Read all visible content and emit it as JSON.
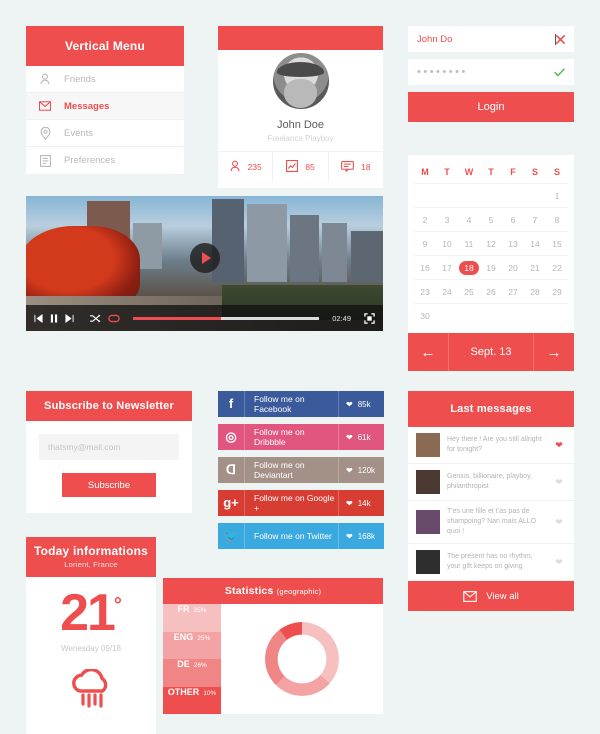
{
  "theme": {
    "accent": "#ef4e4e",
    "bg": "#eef3f4",
    "card": "#ffffff",
    "muted": "#b9b9b9"
  },
  "menu": {
    "title": "Vertical Menu",
    "items": [
      {
        "label": "Friends",
        "icon": "user-icon",
        "active": false
      },
      {
        "label": "Messages",
        "icon": "envelope-icon",
        "active": true
      },
      {
        "label": "Events",
        "icon": "location-pin-icon",
        "active": false
      },
      {
        "label": "Preferences",
        "icon": "list-icon",
        "active": false
      }
    ]
  },
  "profile": {
    "name": "John Doe",
    "role": "Freelance Playboy",
    "avatar_alt": "bearded man in captain hat",
    "stats": [
      {
        "icon": "user-icon",
        "value": "235"
      },
      {
        "icon": "chart-icon",
        "value": "85"
      },
      {
        "icon": "comment-icon",
        "value": "18"
      }
    ]
  },
  "login": {
    "username_value": "John Do",
    "username_clear_icon": "close-icon",
    "password_value": "••••••••",
    "password_valid_icon": "check-icon",
    "button_label": "Login"
  },
  "calendar": {
    "dow": [
      "M",
      "T",
      "W",
      "T",
      "F",
      "S",
      "S"
    ],
    "weeks": [
      [
        "",
        "",
        "",
        "",
        "",
        "",
        "1"
      ],
      [
        "2",
        "3",
        "4",
        "5",
        "6",
        "7",
        "8"
      ],
      [
        "9",
        "10",
        "11",
        "12",
        "13",
        "14",
        "15"
      ],
      [
        "16",
        "17",
        "18",
        "19",
        "20",
        "21",
        "22"
      ],
      [
        "23",
        "24",
        "25",
        "26",
        "27",
        "28",
        "29"
      ],
      [
        "30",
        "",
        "",
        "",
        "",
        "",
        ""
      ]
    ],
    "today": "18",
    "label": "Sept. 13",
    "prev_icon": "arrow-left-icon",
    "next_icon": "arrow-right-icon"
  },
  "video": {
    "image_alt": "city skyline with red autumn trees at sunset",
    "play_icon": "play-icon",
    "controls": [
      {
        "icon": "previous-icon"
      },
      {
        "icon": "pause-icon"
      },
      {
        "icon": "next-icon"
      },
      {
        "icon": "shuffle-icon"
      },
      {
        "icon": "repeat-icon"
      }
    ],
    "time": "02:49",
    "fullscreen_icon": "fullscreen-icon",
    "progress_percent": 47
  },
  "newsletter": {
    "title": "Subscribe to Newsletter",
    "email_placeholder": "thatsmy@mail.com",
    "email_value": "",
    "button_label": "Subscribe"
  },
  "socials": [
    {
      "network": "Facebook",
      "label": "Follow me on Facebook",
      "count": "85k",
      "glyph": "f",
      "color": "#3b5a9b",
      "icon": "facebook-icon"
    },
    {
      "network": "Dribbble",
      "label": "Follow me on Dribbble",
      "count": "61k",
      "glyph": "◎",
      "color": "#e0567f",
      "icon": "dribbble-icon"
    },
    {
      "network": "Deviantart",
      "label": "Follow me on Deviantart",
      "count": "120k",
      "glyph": "ᗡ",
      "color": "#a39188",
      "icon": "deviantart-icon"
    },
    {
      "network": "Google+",
      "label": "Follow me on Google +",
      "count": "14k",
      "glyph": "g+",
      "color": "#d73d32",
      "icon": "googleplus-icon"
    },
    {
      "network": "Twitter",
      "label": "Follow me on Twitter",
      "count": "168k",
      "glyph": "🐦",
      "color": "#3aa9e0",
      "icon": "twitter-icon"
    }
  ],
  "messages": {
    "title": "Last messages",
    "items": [
      {
        "text": "Hey there ! Are you still allright for tonight?",
        "liked": true,
        "avatar": "#8a6a52"
      },
      {
        "text": "Genius, billionaire, playboy, philanthropist",
        "liked": false,
        "avatar": "#4a3a32"
      },
      {
        "text": "T'es une fille et t'as pas de shampoing? Nan mais ALLO quoi !",
        "liked": false,
        "avatar": "#6a4a6a"
      },
      {
        "text": "The present has no rhythm, your gift keeps on giving",
        "liked": false,
        "avatar": "#2e2e2e"
      }
    ],
    "viewall_label": "View all",
    "viewall_icon": "envelope-icon"
  },
  "weather": {
    "title": "Today informations",
    "city": "Lorient, France",
    "temperature": "21",
    "degree": "°",
    "date": "Wenesday 09/18",
    "icon": "rain-cloud-icon"
  },
  "statistics": {
    "title": "Statistics",
    "subtitle": "(geographic)"
  },
  "chart_data": {
    "type": "pie",
    "title": "Statistics (geographic)",
    "categories": [
      "FR",
      "ENG",
      "DE",
      "OTHER"
    ],
    "values": [
      35,
      25,
      26,
      10
    ],
    "labels": [
      "35%",
      "25%",
      "26%",
      "10%"
    ],
    "colors": [
      "#f7c0c0",
      "#f3a3a3",
      "#f08585",
      "#ef4e4e"
    ],
    "donut": true,
    "legend_position": "left"
  }
}
